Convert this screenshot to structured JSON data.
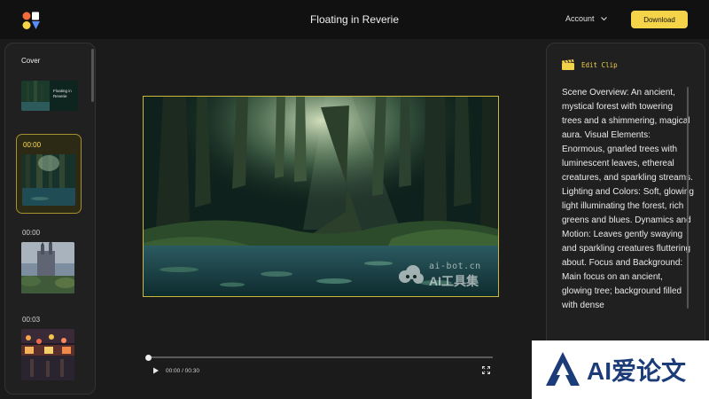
{
  "header": {
    "title": "Floating in Reverie",
    "account_label": "Account",
    "download_label": "Download"
  },
  "left_panel": {
    "cover_label": "Cover",
    "cover_thumb_text": "Floating in Reverie",
    "clips": [
      {
        "time": "00:00",
        "active": true
      },
      {
        "time": "00:00",
        "active": false
      },
      {
        "time": "00:03",
        "active": false
      }
    ]
  },
  "player": {
    "watermark_top": "ai-bot.cn",
    "watermark_bottom": "AI工具集",
    "time": "00:00 / 00:30",
    "progress": 0
  },
  "right_panel": {
    "edit_label": "Edit Clip",
    "description": "Scene Overview: An ancient, mystical forest with towering trees and a shimmering, magical aura. Visual Elements: Enormous, gnarled trees with luminescent leaves, ethereal creatures, and sparkling streams. Lighting and Colors: Soft, glowing light illuminating the forest, rich greens and blues. Dynamics and Motion: Leaves gently swaying and sparkling creatures fluttering about. Focus and Background: Main focus on an ancient, glowing tree; background filled with dense"
  },
  "badge": {
    "text": "AI爱论文"
  },
  "colors": {
    "accent": "#f5d44a",
    "background": "#1b1b1b",
    "panel": "#202020",
    "header": "#111111"
  },
  "icons": [
    "logo-icon",
    "chevron-down-icon",
    "clapperboard-icon",
    "play-icon",
    "fullscreen-icon",
    "watermark-cloud-icon",
    "badge-logo-icon"
  ]
}
